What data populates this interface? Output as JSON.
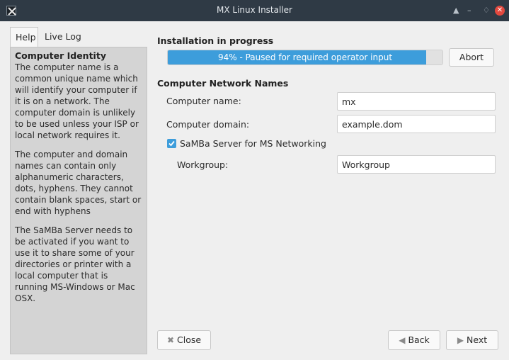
{
  "window": {
    "title": "MX Linux Installer",
    "controls": [
      "▲",
      "–",
      "♢",
      "✕"
    ]
  },
  "left_panel": {
    "tabs": [
      {
        "label": "Help",
        "active": true
      },
      {
        "label": "Live Log",
        "active": false
      }
    ],
    "help": {
      "heading": "Computer Identity",
      "paragraphs": [
        "The computer name is a common unique name which will identify your computer if it is on a network. The computer domain is unlikely to be used unless your ISP or local network requires it.",
        "The computer and domain names can contain only alphanumeric characters, dots, hyphens. They cannot contain blank spaces, start or end with hyphens",
        "The SaMBa Server needs to be activated if you want to use it to share some of your directories or printer with a local computer that is running MS-Windows or Mac OSX."
      ]
    }
  },
  "progress": {
    "section_title": "Installation in progress",
    "percent": 94,
    "text": "94% - Paused for required operator input",
    "abort_label": "Abort",
    "fill_color": "#3d9ddb"
  },
  "network": {
    "section_title": "Computer Network Names",
    "computer_name_label": "Computer name:",
    "computer_name_value": "mx",
    "computer_domain_label": "Computer domain:",
    "computer_domain_value": "example.dom",
    "samba_label": "SaMBa Server for MS Networking",
    "samba_checked": true,
    "workgroup_label": "Workgroup:",
    "workgroup_value": "Workgroup"
  },
  "footer": {
    "close_label": "Close",
    "back_label": "Back",
    "next_label": "Next"
  }
}
